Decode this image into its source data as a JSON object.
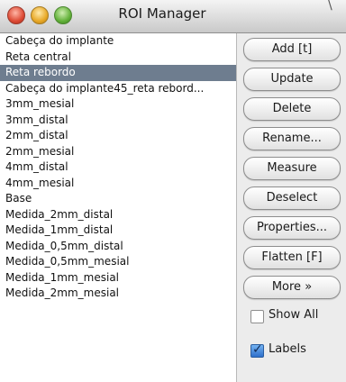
{
  "window": {
    "title": "ROI Manager",
    "corner_glyph": "\\ "
  },
  "roi_list": {
    "items": [
      "Cabeça do implante",
      "Reta central",
      "Reta rebordo",
      "Cabeça do implante45_reta rebord...",
      "3mm_mesial",
      "3mm_distal",
      "2mm_distal",
      "2mm_mesial",
      "4mm_distal",
      "4mm_mesial",
      "Base",
      "Medida_2mm_distal",
      "Medida_1mm_distal",
      "Medida_0,5mm_distal",
      "Medida_0,5mm_mesial",
      "Medida_1mm_mesial",
      "Medida_2mm_mesial"
    ],
    "selected_index": 2
  },
  "buttons": {
    "add": "Add [t]",
    "update": "Update",
    "delete": "Delete",
    "rename": "Rename...",
    "measure": "Measure",
    "deselect": "Deselect",
    "properties": "Properties...",
    "flatten": "Flatten [F]",
    "more": "More »"
  },
  "options": {
    "show_all": {
      "label": "Show All",
      "checked": false
    },
    "labels": {
      "label": "Labels",
      "checked": true
    }
  }
}
